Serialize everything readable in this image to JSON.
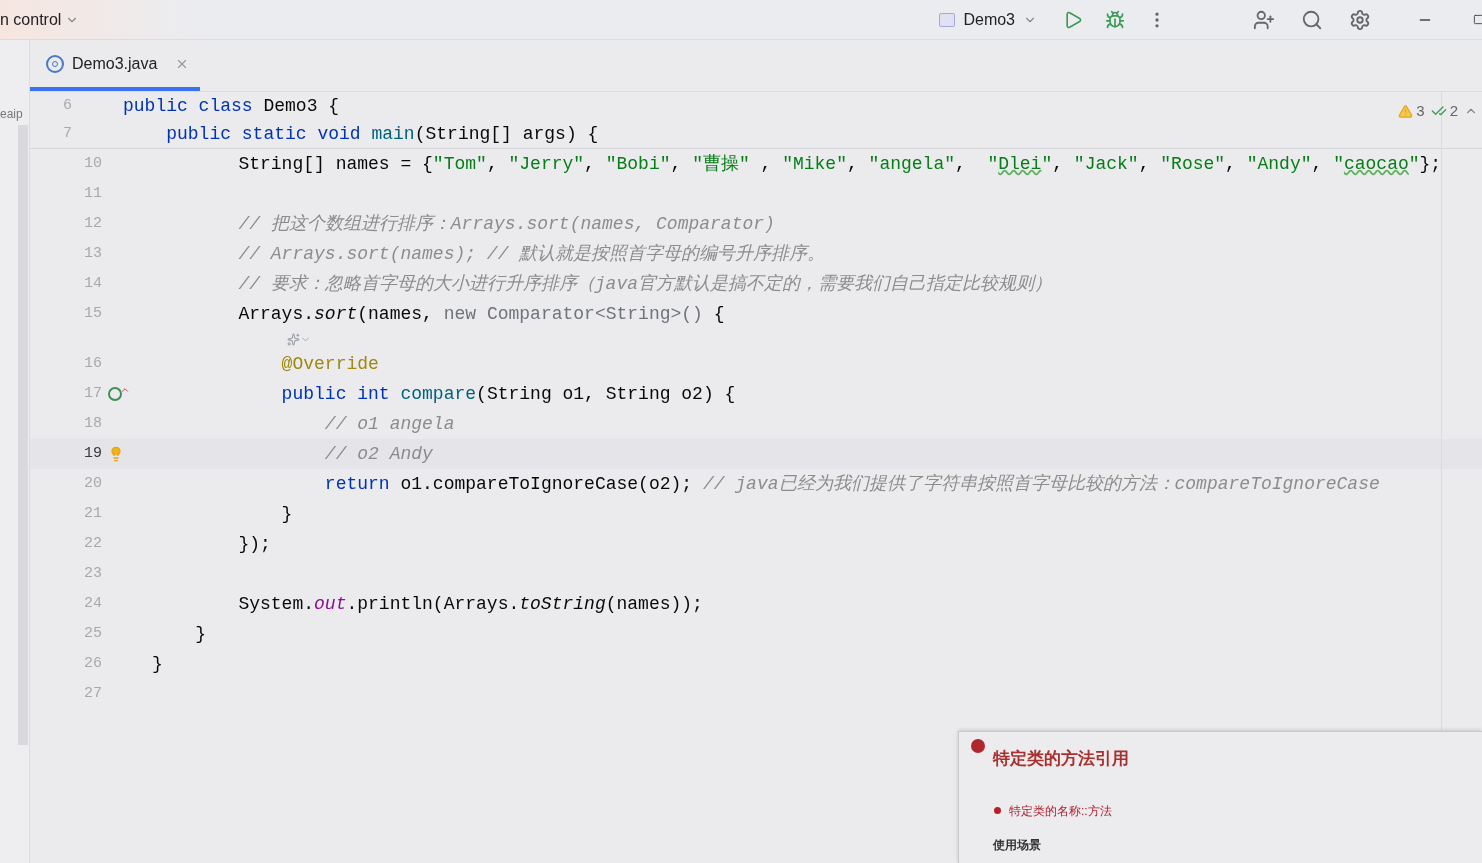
{
  "toolbar": {
    "project_menu": "n control",
    "run_config": "Demo3"
  },
  "tabs": [
    {
      "label": "Demo3.java",
      "selected": true
    }
  ],
  "side_panel_text": "eaip",
  "inspections": {
    "warnings": "3",
    "checks": "2"
  },
  "sticky_lines": [
    {
      "number": "6",
      "tokens": [
        {
          "kind": "keyword",
          "text": "public class "
        },
        {
          "kind": "plain",
          "text": "Demo3 {"
        }
      ]
    },
    {
      "number": "7",
      "tokens": [
        {
          "kind": "keyword",
          "text": "    public static void "
        },
        {
          "kind": "method",
          "text": "main"
        },
        {
          "kind": "plain",
          "text": "(String[] args) {"
        }
      ]
    }
  ],
  "lines": [
    {
      "kind": "code",
      "number": "10",
      "current": false,
      "tokens": [
        {
          "kind": "plain",
          "text": "        String[] names = {"
        },
        {
          "kind": "string",
          "text": "\"Tom\""
        },
        {
          "kind": "plain",
          "text": ", "
        },
        {
          "kind": "string",
          "text": "\"Jerry\""
        },
        {
          "kind": "plain",
          "text": ", "
        },
        {
          "kind": "string",
          "text": "\"Bobi\""
        },
        {
          "kind": "plain",
          "text": ", "
        },
        {
          "kind": "string",
          "text": "\"曹操\""
        },
        {
          "kind": "plain",
          "text": " , "
        },
        {
          "kind": "string",
          "text": "\"Mike\""
        },
        {
          "kind": "plain",
          "text": ", "
        },
        {
          "kind": "string",
          "text": "\"angela\""
        },
        {
          "kind": "plain",
          "text": ",  "
        },
        {
          "kind": "string",
          "text": "\""
        },
        {
          "kind": "typo",
          "text": "Dlei"
        },
        {
          "kind": "string",
          "text": "\""
        },
        {
          "kind": "plain",
          "text": ", "
        },
        {
          "kind": "string",
          "text": "\"Jack\""
        },
        {
          "kind": "plain",
          "text": ", "
        },
        {
          "kind": "string",
          "text": "\"Rose\""
        },
        {
          "kind": "plain",
          "text": ", "
        },
        {
          "kind": "string",
          "text": "\"Andy\""
        },
        {
          "kind": "plain",
          "text": ", "
        },
        {
          "kind": "string",
          "text": "\""
        },
        {
          "kind": "typo",
          "text": "caocao"
        },
        {
          "kind": "string",
          "text": "\""
        },
        {
          "kind": "plain",
          "text": "};"
        }
      ]
    },
    {
      "kind": "code",
      "number": "11",
      "current": false
    },
    {
      "kind": "code",
      "number": "12",
      "current": false,
      "tokens": [
        {
          "kind": "comment",
          "text": "        // 把这个数组进行排序：Arrays.sort(names, Comparator)"
        }
      ]
    },
    {
      "kind": "code",
      "number": "13",
      "current": false,
      "tokens": [
        {
          "kind": "comment",
          "text": "        // Arrays.sort(names); // 默认就是按照首字母的编号升序排序。"
        }
      ]
    },
    {
      "kind": "code",
      "number": "14",
      "current": false,
      "tokens": [
        {
          "kind": "comment",
          "text": "        // 要求：忽略首字母的大小进行升序排序（java官方默认是搞不定的，需要我们自己指定比较规则）"
        }
      ]
    },
    {
      "kind": "code",
      "number": "15",
      "current": false,
      "tokens": [
        {
          "kind": "plain",
          "text": "        Arrays."
        },
        {
          "kind": "static_method",
          "text": "sort"
        },
        {
          "kind": "plain",
          "text": "(names, "
        },
        {
          "kind": "faded",
          "text": "new Comparator<String>()"
        },
        {
          "kind": "plain",
          "text": " {"
        }
      ]
    },
    {
      "kind": "inlay"
    },
    {
      "kind": "code",
      "number": "16",
      "current": false,
      "tokens": [
        {
          "kind": "annotation",
          "text": "            @Override"
        }
      ]
    },
    {
      "kind": "code",
      "number": "17",
      "current": false,
      "gutter": {
        "kind": "implements"
      },
      "tokens": [
        {
          "kind": "keyword",
          "text": "            public int "
        },
        {
          "kind": "method",
          "text": "compare"
        },
        {
          "kind": "plain",
          "text": "(String o1, String o2) {"
        }
      ]
    },
    {
      "kind": "code",
      "number": "18",
      "current": false,
      "tokens": [
        {
          "kind": "comment",
          "text": "                // o1 angela"
        }
      ]
    },
    {
      "kind": "code",
      "number": "19",
      "current": true,
      "gutter": {
        "kind": "bulb"
      },
      "tokens": [
        {
          "kind": "comment",
          "text": "                // o2 Andy"
        }
      ]
    },
    {
      "kind": "code",
      "number": "20",
      "current": false,
      "tokens": [
        {
          "kind": "keyword",
          "text": "                return "
        },
        {
          "kind": "plain",
          "text": "o1.compareToIgnoreCase(o2); "
        },
        {
          "kind": "comment",
          "text": "// java已经为我们提供了字符串按照首字母比较的方法：compareToIgnoreCase"
        }
      ]
    },
    {
      "kind": "code",
      "number": "21",
      "current": false,
      "tokens": [
        {
          "kind": "plain",
          "text": "            }"
        }
      ]
    },
    {
      "kind": "code",
      "number": "22",
      "current": false,
      "tokens": [
        {
          "kind": "plain",
          "text": "        });"
        }
      ]
    },
    {
      "kind": "code",
      "number": "23",
      "current": false
    },
    {
      "kind": "code",
      "number": "24",
      "current": false,
      "tokens": [
        {
          "kind": "plain",
          "text": "        System."
        },
        {
          "kind": "static_field",
          "text": "out"
        },
        {
          "kind": "plain",
          "text": ".println(Arrays."
        },
        {
          "kind": "static_method",
          "text": "toString"
        },
        {
          "kind": "plain",
          "text": "(names));"
        }
      ]
    },
    {
      "kind": "code",
      "number": "25",
      "current": false,
      "tokens": [
        {
          "kind": "plain",
          "text": "    }"
        }
      ]
    },
    {
      "kind": "code",
      "number": "26",
      "current": false,
      "tokens": [
        {
          "kind": "plain",
          "text": "}"
        }
      ]
    },
    {
      "kind": "code",
      "number": "27",
      "current": false
    }
  ],
  "notes_popup": {
    "title": "特定类的方法引用",
    "bullet": "特定类的名称::方法",
    "heading": "使用场景"
  }
}
